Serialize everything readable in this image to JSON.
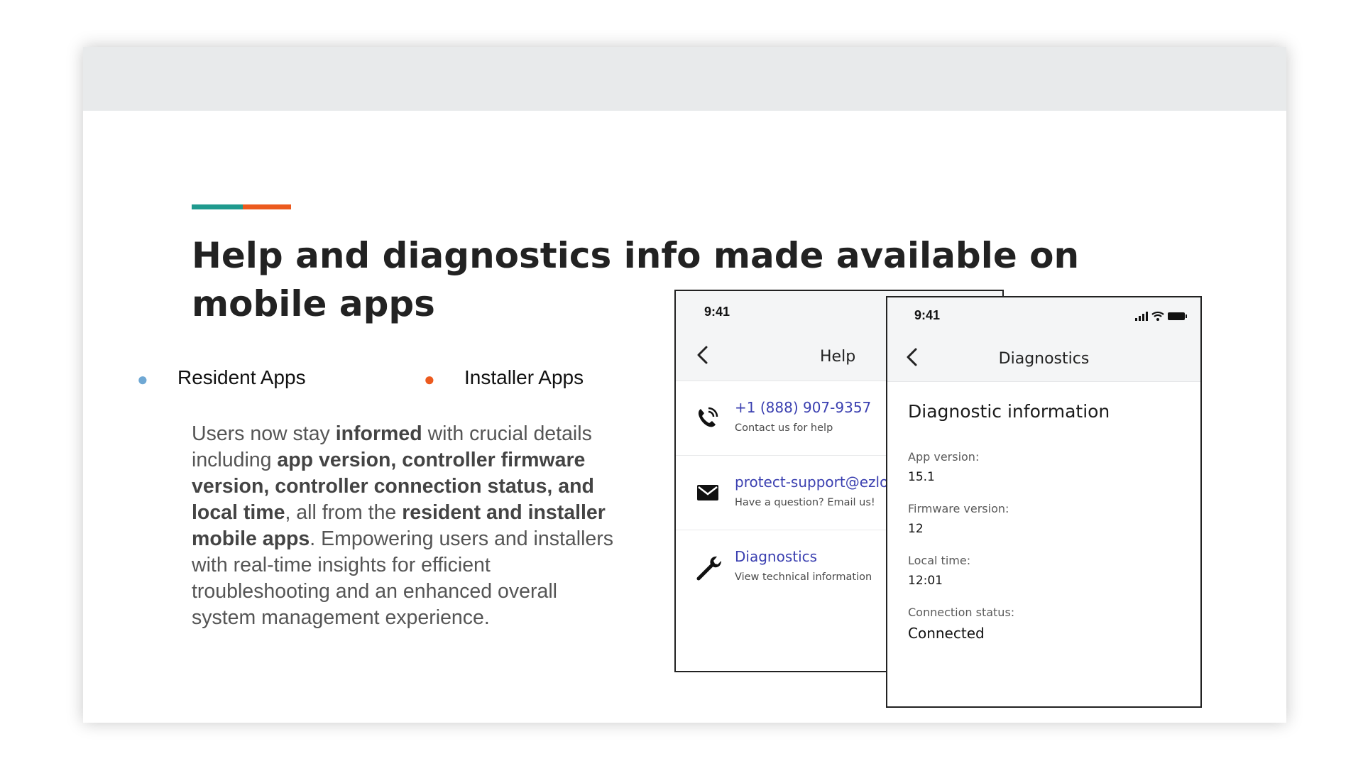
{
  "slide": {
    "title": "Help and diagnostics info made available on mobile apps",
    "bullets": [
      {
        "label": "Resident Apps",
        "dot_color": "#6fa8d4"
      },
      {
        "label": "Installer Apps",
        "dot_color": "#ec5a1e"
      }
    ],
    "body": {
      "t1": "Users now stay ",
      "b1": "informed",
      "t2": " with crucial details including ",
      "b2": "app version, controller firmware version, controller connection status, and local time",
      "t3": ", all from the ",
      "b3": "resident and installer mobile apps",
      "t4": ". Empowering users and installers with real-time insights for efficient troubleshooting and an enhanced overall system management experience."
    },
    "accent_colors": {
      "teal": "#1f9a8e",
      "orange": "#ec5a1e"
    }
  },
  "help_screen": {
    "time": "9:41",
    "title": "Help",
    "back_icon": "chevron-left-icon",
    "items": [
      {
        "icon": "phone-icon",
        "title": "+1 (888) 907-9357",
        "subtitle": "Contact us for help"
      },
      {
        "icon": "mail-icon",
        "title": "protect-support@ezlo.com",
        "subtitle": "Have a question? Email us!"
      },
      {
        "icon": "wrench-icon",
        "title": "Diagnostics",
        "subtitle": "View technical information"
      }
    ]
  },
  "diagnostics_screen": {
    "time": "9:41",
    "title": "Diagnostics",
    "back_icon": "chevron-left-icon",
    "status_icons": [
      "signal-icon",
      "wifi-icon",
      "battery-icon"
    ],
    "heading": "Diagnostic information",
    "fields": [
      {
        "label": "App version:",
        "value": "15.1"
      },
      {
        "label": "Firmware version:",
        "value": "12"
      },
      {
        "label": "Local time:",
        "value": "12:01"
      },
      {
        "label": "Connection status:",
        "value": "Connected"
      }
    ]
  }
}
